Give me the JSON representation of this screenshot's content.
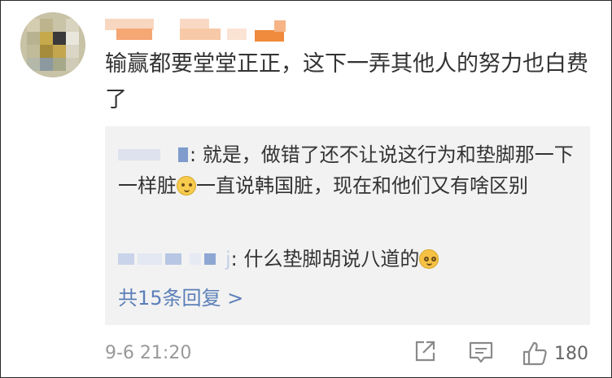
{
  "post": {
    "comment_text": "输赢都要堂堂正正，这下一弄其他人的努力也白费了",
    "timestamp": "9-6 21:20",
    "like_count": "180"
  },
  "replies": [
    {
      "name_suffix": "",
      "text_part1": ": 就是，做错了还不让说这行为和垫脚那一下一样脏",
      "emoji": "fingers-on-mouth-emoji",
      "text_part2": "一直说韩国脏，现在和他们又有啥区别"
    },
    {
      "name_suffix": "j",
      "text_part1": ": 什么垫脚胡说八道的",
      "emoji": "dizzy-face-emoji"
    }
  ],
  "more_replies_label": "共15条回复 >",
  "colors": {
    "link": "#5b7fb8",
    "reply_bg": "#f2f2f2",
    "meta_text": "#999999",
    "name_blur_accent": "#f08a3c"
  }
}
